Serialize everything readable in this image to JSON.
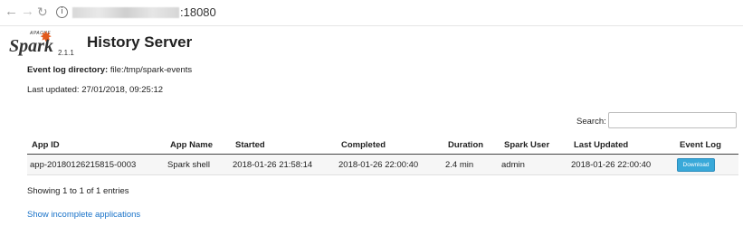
{
  "browser": {
    "url_port": ":18080",
    "nav_back": "←",
    "nav_forward": "→",
    "nav_reload": "↻",
    "info_glyph": "i"
  },
  "header": {
    "logo_apache": "APACHE",
    "logo_word": "Spark",
    "logo_icon": "spark-star-icon",
    "version": "2.1.1",
    "title": "History Server"
  },
  "info": {
    "event_log_label": "Event log directory:",
    "event_log_value": "file:/tmp/spark-events",
    "last_updated_label": "Last updated:",
    "last_updated_value": "27/01/2018, 09:25:12"
  },
  "search": {
    "label": "Search:",
    "value": ""
  },
  "table": {
    "columns": [
      "App ID",
      "App Name",
      "Started",
      "Completed",
      "Duration",
      "Spark User",
      "Last Updated",
      "Event Log"
    ],
    "rows": [
      {
        "app_id": "app-20180126215815-0003",
        "app_name": "Spark shell",
        "started": "2018-01-26 21:58:14",
        "completed": "2018-01-26 22:00:40",
        "duration": "2.4 min",
        "spark_user": "admin",
        "last_updated": "2018-01-26 22:00:40",
        "event_log": "Download"
      }
    ]
  },
  "footer": {
    "showing": "Showing 1 to 1 of 1 entries",
    "incomplete_link": "Show incomplete applications"
  },
  "colors": {
    "link": "#1a73c9",
    "download_button": "#39a9d9",
    "spark_orange": "#e25a1c"
  }
}
